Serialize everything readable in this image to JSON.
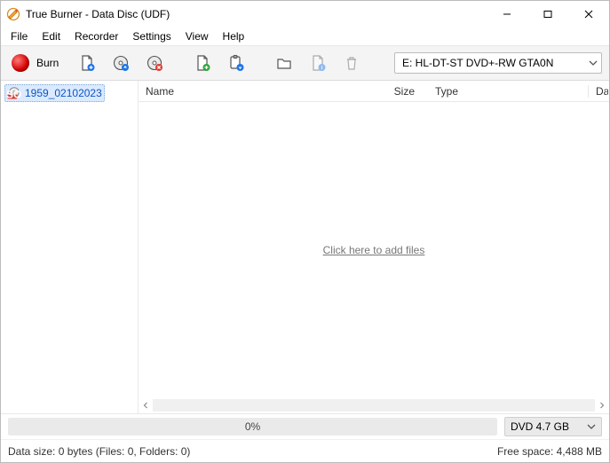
{
  "titlebar": {
    "title": "True Burner - Data Disc (UDF)"
  },
  "menu": {
    "file": "File",
    "edit": "Edit",
    "recorder": "Recorder",
    "settings": "Settings",
    "view": "View",
    "help": "Help"
  },
  "toolbar": {
    "burn": "Burn",
    "drive_selected": "E: HL-DT-ST DVD+-RW GTA0N",
    "icons": {
      "addfile": "add-file-icon",
      "disc_eject": "disc-eject-icon",
      "disc_close": "disc-close-icon",
      "newfile": "file-add-icon",
      "paste": "paste-icon",
      "folder": "folder-icon",
      "info": "file-info-icon",
      "trash": "trash-icon"
    }
  },
  "tree": {
    "items": [
      {
        "label": "1959_02102023"
      }
    ]
  },
  "cols": {
    "name": "Name",
    "size": "Size",
    "type": "Type",
    "dat": "Dat"
  },
  "files": {
    "empty_hint": "Click here to add files"
  },
  "progress": {
    "percent": "0%",
    "disc_type": "DVD 4.7 GB"
  },
  "status": {
    "left": "Data size: 0 bytes (Files: 0, Folders: 0)",
    "right": "Free space: 4,488 MB"
  }
}
